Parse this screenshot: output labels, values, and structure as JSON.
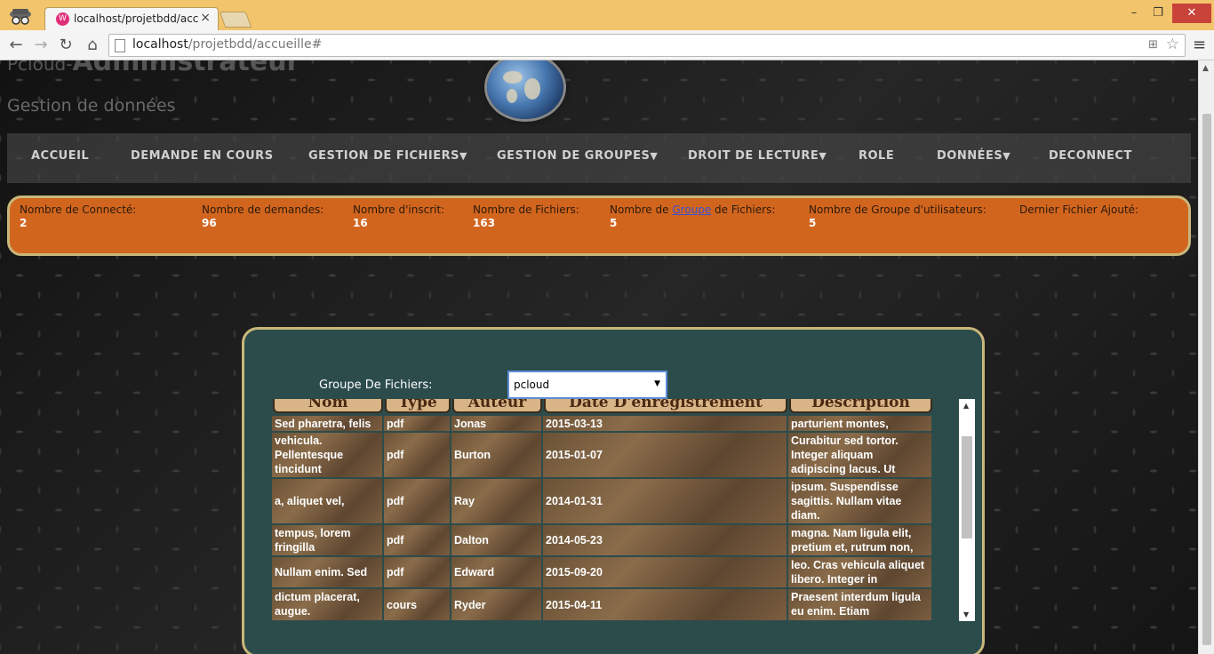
{
  "browser": {
    "tab_title": "localhost/projetbdd/accu",
    "tab_favicon": "W",
    "url_host": "localhost",
    "url_path": "/projetbdd/accueille#"
  },
  "site": {
    "title_prefix": "Pcloud-",
    "title_main": "Administrateur",
    "subtitle": "Gestion de données"
  },
  "nav": [
    {
      "label": "ACCUEIL",
      "caret": ""
    },
    {
      "label": "DEMANDE EN COURS",
      "caret": ""
    },
    {
      "label": "GESTION DE FICHIERS",
      "caret": "▼"
    },
    {
      "label": "GESTION DE GROUPES",
      "caret": "▼"
    },
    {
      "label": "DROIT DE LECTURE",
      "caret": "▼"
    },
    {
      "label": "ROLE",
      "caret": ""
    },
    {
      "label": "DONNÉES",
      "caret": "▼"
    },
    {
      "label": "DECONNECT",
      "caret": ""
    }
  ],
  "stats": {
    "connectes": {
      "label": "Nombre de Connecté:",
      "value": "2"
    },
    "demandes": {
      "label": "Nombre de demandes:",
      "value": "96"
    },
    "inscrits": {
      "label": "Nombre d'inscrit:",
      "value": "16"
    },
    "fichiers": {
      "label": "Nombre de Fichiers:",
      "value": "163"
    },
    "groupe_fichiers": {
      "label_before": "Nombre de ",
      "label_link": "Groupe",
      "label_after": " de Fichiers:",
      "value": "5"
    },
    "groupe_users": {
      "label": "Nombre de Groupe d'utilisateurs:",
      "value": "5"
    },
    "dernier": {
      "label": "Dernier Fichier Ajouté:",
      "value": ""
    }
  },
  "filter": {
    "label": "Groupe De Fichiers:",
    "selected": "pcloud"
  },
  "table": {
    "headers": [
      "Nom",
      "Type",
      "Auteur",
      "Date D'enregistrement",
      "Description"
    ],
    "rows": [
      [
        "Sed pharetra, felis",
        "pdf",
        "Jonas",
        "2015-03-13",
        "parturient montes,"
      ],
      [
        "vehicula. Pellentesque tincidunt",
        "pdf",
        "Burton",
        "2015-01-07",
        "Curabitur sed tortor. Integer aliquam adipiscing lacus. Ut"
      ],
      [
        "a, aliquet vel,",
        "pdf",
        "Ray",
        "2014-01-31",
        "ipsum. Suspendisse sagittis. Nullam vitae diam."
      ],
      [
        "tempus, lorem fringilla",
        "pdf",
        "Dalton",
        "2014-05-23",
        "magna. Nam ligula elit, pretium et, rutrum non,"
      ],
      [
        "Nullam enim. Sed",
        "pdf",
        "Edward",
        "2015-09-20",
        "leo. Cras vehicula aliquet libero. Integer in"
      ],
      [
        "dictum placerat, augue.",
        "cours",
        "Ryder",
        "2015-04-11",
        "Praesent interdum ligula eu enim. Etiam"
      ]
    ]
  },
  "colors": {
    "stats_bg": "#d2651e",
    "panel_bg": "#2c4c4c",
    "border_gold": "#c9b77a",
    "header_tan": "#d8b487"
  },
  "icons": [
    "incognito-icon",
    "back-icon",
    "forward-icon",
    "reload-icon",
    "home-icon",
    "page-icon",
    "translate-icon",
    "star-icon",
    "menu-icon",
    "globe-logo"
  ]
}
